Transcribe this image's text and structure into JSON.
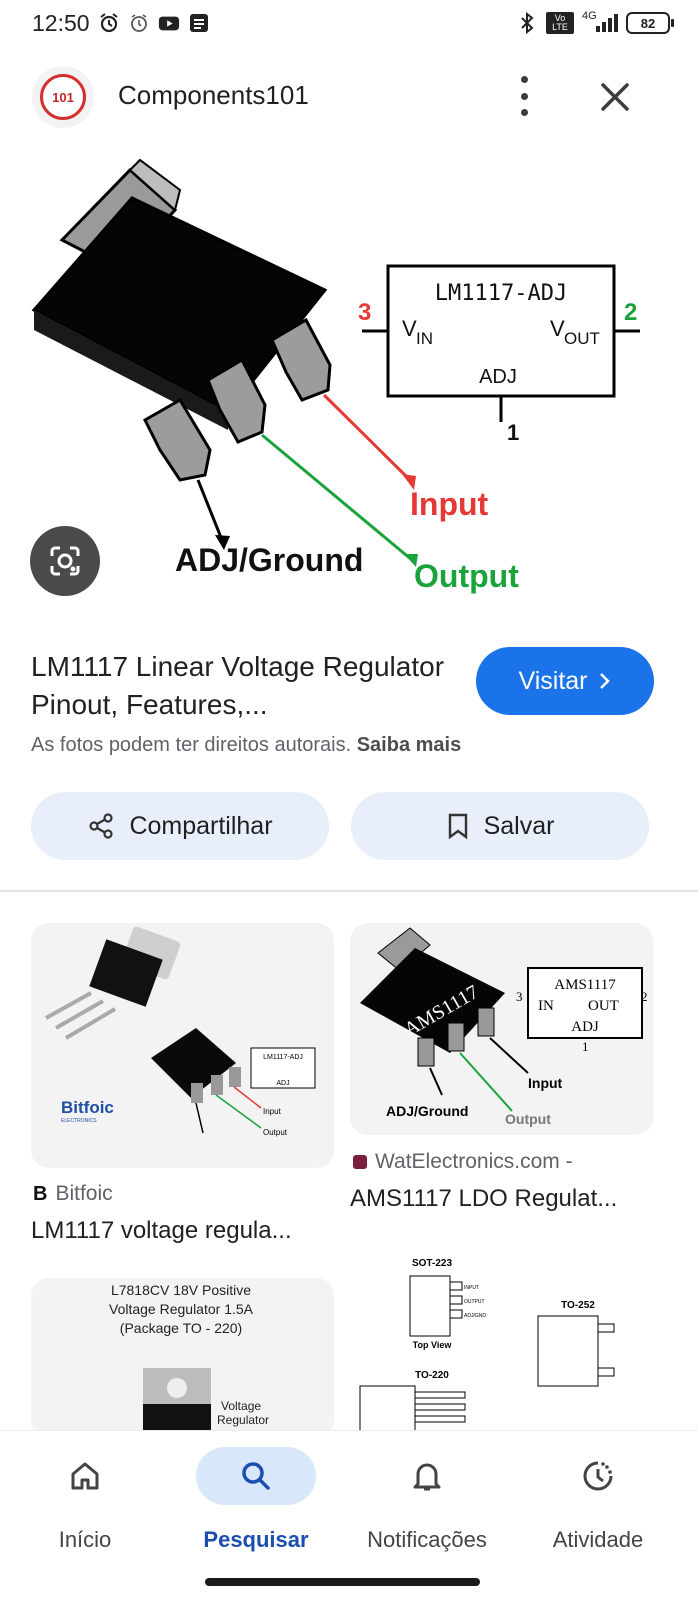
{
  "status_bar": {
    "time": "12:50",
    "network": "4G",
    "volte": "Vo LTE",
    "battery": "82",
    "left_icons": [
      "alarm-icon",
      "alarm-clock-icon",
      "youtube-icon",
      "news-icon"
    ],
    "right_icons": [
      "bluetooth-icon",
      "volte-icon",
      "signal-icon",
      "battery-icon"
    ]
  },
  "header": {
    "site_logo_text": "101",
    "site_name": "Components101"
  },
  "main_image": {
    "chip_label": "LM1117-ADJ",
    "vin_label": "V",
    "vin_sub": "IN",
    "vout_label": "V",
    "vout_sub": "OUT",
    "adj_label": "ADJ",
    "pin3": "3",
    "pin2": "2",
    "pin1": "1",
    "input_label": "Input",
    "output_label": "Output",
    "ground_label": "ADJ/Ground"
  },
  "result": {
    "title": "LM1117 Linear Voltage Regulator Pinout, Features,...",
    "visit_label": "Visitar",
    "copyright_text": "As fotos podem ter direitos autorais.",
    "learn_more": "Saiba mais",
    "share_label": "Compartilhar",
    "save_label": "Salvar"
  },
  "related": [
    {
      "source": "Bitfoic",
      "title": "LM1117 voltage regula...",
      "thumb_brand": "Bitfoic",
      "thumb_brand_sub": "ELECTRONICS",
      "thumb_chip": "LM1117-ADJ",
      "thumb_input": "Input",
      "thumb_output": "Output",
      "thumb_adj": "ADJ"
    },
    {
      "source": "WatElectronics.com -",
      "title": "AMS1117 LDO Regulat...",
      "thumb_chip": "AMS1117",
      "thumb_body_text": "AMS1117",
      "thumb_in": "IN",
      "thumb_out": "OUT",
      "thumb_adj": "ADJ",
      "thumb_pin3": "3",
      "thumb_pin2": "2",
      "thumb_pin1": "1",
      "thumb_input": "Input",
      "thumb_output": "Output",
      "thumb_ground": "ADJ/Ground"
    },
    {
      "thumb_line1": "L7818CV 18V Positive",
      "thumb_line2": "Voltage Regulator 1.5A",
      "thumb_line3": "(Package TO - 220)",
      "thumb_caption1": "Voltage",
      "thumb_caption2": "Regulator"
    },
    {
      "thumb_sot": "SOT-223",
      "thumb_to252": "TO-252",
      "thumb_to220": "TO-220",
      "thumb_topview": "Top View",
      "thumb_input": "INPUT",
      "thumb_output": "OUTPUT",
      "thumb_adj": "ADJ/GND"
    }
  ],
  "bottom_nav": [
    {
      "label": "Início",
      "icon": "home-icon",
      "active": false
    },
    {
      "label": "Pesquisar",
      "icon": "search-icon",
      "active": true
    },
    {
      "label": "Notificações",
      "icon": "bell-icon",
      "active": false
    },
    {
      "label": "Atividade",
      "icon": "activity-icon",
      "active": false
    }
  ],
  "colors": {
    "accent": "#1a73e8",
    "pill_bg": "#e8effa",
    "input_wire": "#e53935",
    "output_wire": "#1aa33b",
    "nav_active": "#d9e7fb"
  }
}
